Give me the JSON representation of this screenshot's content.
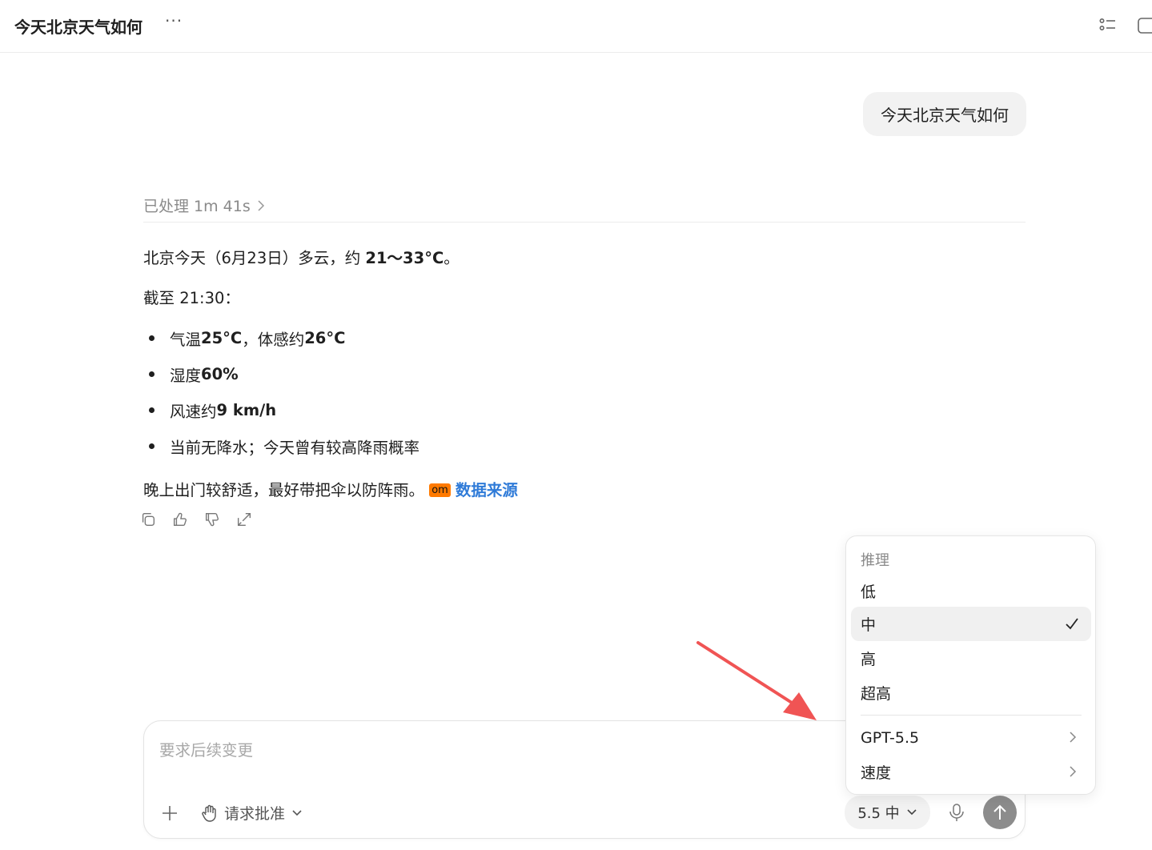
{
  "header": {
    "title": "今天北京天气如何",
    "more_label": "···"
  },
  "chat": {
    "user_message": "今天北京天气如何",
    "processed_label": "已处理 1m 41s",
    "summary_prefix": "北京今天（6月23日）多云，约 ",
    "summary_temp": "21～33°C",
    "summary_suffix": "。",
    "as_of": "截至 21:30：",
    "bullets": [
      {
        "label": "气温 ",
        "value": "25°C",
        "mid": "，体感约 ",
        "value2": "26°C"
      },
      {
        "label": "湿度 ",
        "value": "60%"
      },
      {
        "label": "风速约 ",
        "value": "9 km/h"
      },
      {
        "label": "当前无降水；今天曾有较高降雨概率"
      }
    ],
    "closing": "晚上出门较舒适，最好带把伞以防阵雨。",
    "source_badge": "om",
    "source_link": "数据来源"
  },
  "composer": {
    "placeholder": "要求后续变更",
    "approve_label": "请求批准",
    "model_label": "5.5 中"
  },
  "dropdown": {
    "header": "推理",
    "items": [
      "低",
      "中",
      "高",
      "超高"
    ],
    "selected": "中",
    "model": "GPT-5.5",
    "speed": "速度"
  },
  "colors": {
    "accent_link": "#2f7bd8",
    "badge": "#ff7a00",
    "arrow": "#f05454"
  }
}
